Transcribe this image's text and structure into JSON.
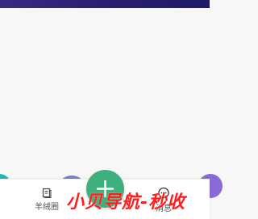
{
  "tab_bar": {
    "tabs": [
      {
        "label": "羊绒圈",
        "icon": "document-icon"
      },
      {
        "label": "",
        "icon": "add-icon"
      },
      {
        "label": "消息",
        "icon": "chat-bubble-icon"
      }
    ]
  },
  "watermark": {
    "text": "小贝导航-秒收"
  },
  "colors": {
    "status_bar": "#2d1f73",
    "fab": "#3eb07d",
    "watermark": "#ff1d1d",
    "tab_label": "#555555"
  }
}
